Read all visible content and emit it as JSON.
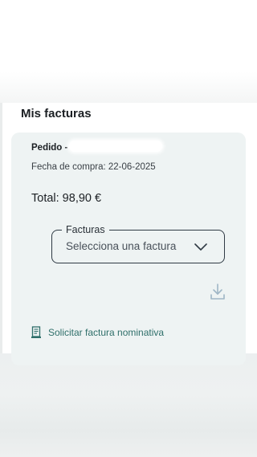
{
  "page": {
    "title": "Mis facturas"
  },
  "order": {
    "label": "Pedido ",
    "number_visible": "-",
    "purchase_date": "Fecha de compra: 22-06-2025",
    "total": "Total: 98,90 €"
  },
  "invoice_select": {
    "label": "Facturas",
    "placeholder": "Selecciona una factura",
    "icon": "chevron-down-icon"
  },
  "actions": {
    "download_icon": "download-icon",
    "request_label": "Solicitar factura nominativa",
    "request_icon": "document-icon"
  },
  "colors": {
    "card_background": "#eef3f3",
    "link_teal": "#2f6f6a",
    "download_icon_color": "#9fb6c6"
  }
}
